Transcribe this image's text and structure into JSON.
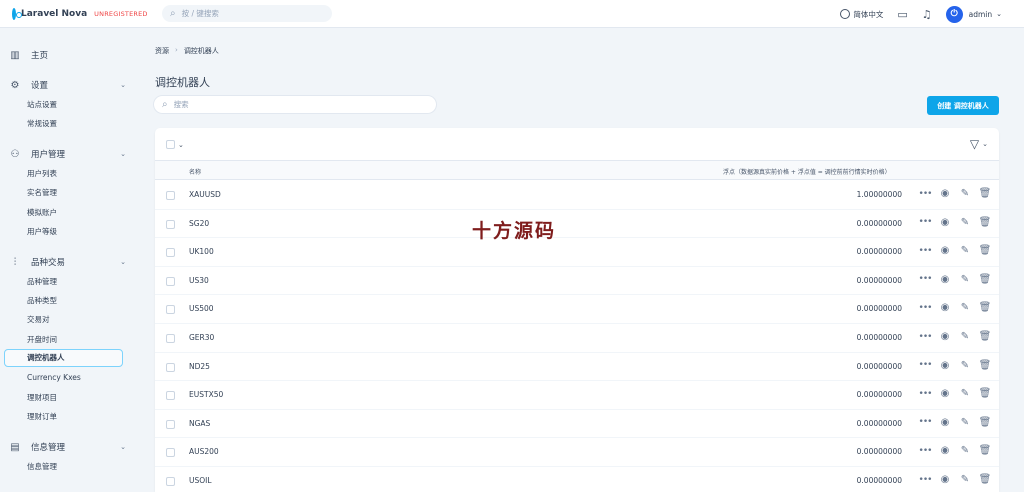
{
  "app": {
    "name": "Laravel Nova",
    "badge": "UNREGISTERED"
  },
  "global_search": {
    "placeholder": "按 / 键搜索"
  },
  "topbar": {
    "language": "简体中文",
    "user": "admin",
    "avatar_icon": "power-icon"
  },
  "sidebar": {
    "groups": [
      {
        "label": "主页",
        "icon": "dashboard-icon",
        "items": []
      },
      {
        "label": "设置",
        "icon": "gear-icon",
        "items": [
          "站点设置",
          "常规设置"
        ]
      },
      {
        "label": "用户管理",
        "icon": "users-icon",
        "items": [
          "用户列表",
          "实名管理",
          "模拟账户",
          "用户等级"
        ]
      },
      {
        "label": "品种交易",
        "icon": "sliders-icon",
        "items": [
          "品种管理",
          "品种类型",
          "交易对",
          "开盘时间",
          "调控机器人",
          "Currency Kxes",
          "理财项目",
          "理财订单"
        ]
      },
      {
        "label": "信息管理",
        "icon": "chat-icon",
        "items": [
          "信息管理"
        ]
      }
    ],
    "active_item": "调控机器人"
  },
  "breadcrumb": [
    "资源",
    "调控机器人"
  ],
  "page_title": "调控机器人",
  "resource_search": {
    "placeholder": "搜索"
  },
  "create_button": "创建 调控机器人",
  "table": {
    "columns": {
      "name": "名称",
      "spread": "浮点（数据源真实前价格 + 浮点值 = 调控前前行情实时价格）"
    },
    "rows": [
      {
        "name": "XAUUSD",
        "spread": "1.00000000"
      },
      {
        "name": "SG20",
        "spread": "0.00000000"
      },
      {
        "name": "UK100",
        "spread": "0.00000000"
      },
      {
        "name": "US30",
        "spread": "0.00000000"
      },
      {
        "name": "US500",
        "spread": "0.00000000"
      },
      {
        "name": "GER30",
        "spread": "0.00000000"
      },
      {
        "name": "ND25",
        "spread": "0.00000000"
      },
      {
        "name": "EUSTX50",
        "spread": "0.00000000"
      },
      {
        "name": "NGAS",
        "spread": "0.00000000"
      },
      {
        "name": "AUS200",
        "spread": "0.00000000"
      },
      {
        "name": "USOIL",
        "spread": "0.00000000"
      }
    ]
  },
  "watermark": "十方源码",
  "colors": {
    "accent": "#0ea5e9",
    "badge": "#ef4444",
    "background": "#f1f5f9"
  }
}
